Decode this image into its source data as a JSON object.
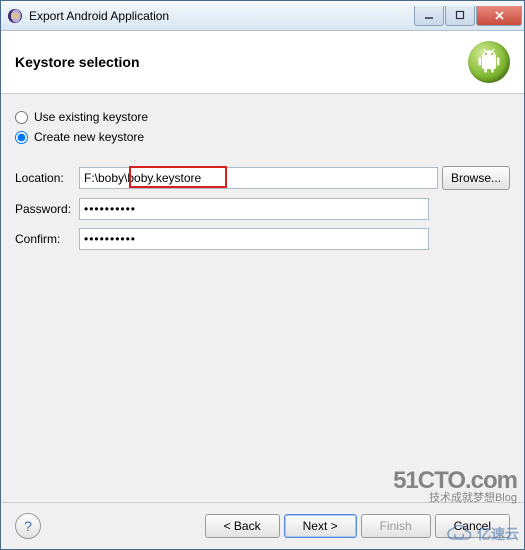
{
  "titlebar": {
    "title": "Export Android Application"
  },
  "header": {
    "title": "Keystore selection"
  },
  "keystore": {
    "use_existing_label": "Use existing keystore",
    "create_new_label": "Create new keystore",
    "selected_option": "create_new"
  },
  "form": {
    "location_label": "Location:",
    "location_value": "F:\\boby\\boby.keystore",
    "browse_label": "Browse...",
    "password_label": "Password:",
    "password_value": "••••••••••",
    "confirm_label": "Confirm:",
    "confirm_value": "••••••••••"
  },
  "footer": {
    "help_label": "?",
    "back_label": "< Back",
    "next_label": "Next >",
    "finish_label": "Finish",
    "cancel_label": "Cancel"
  },
  "watermarks": {
    "cto_line1": "51CTO.com",
    "cto_line2": "技术成就梦想Blog",
    "yisu": "亿速云"
  }
}
